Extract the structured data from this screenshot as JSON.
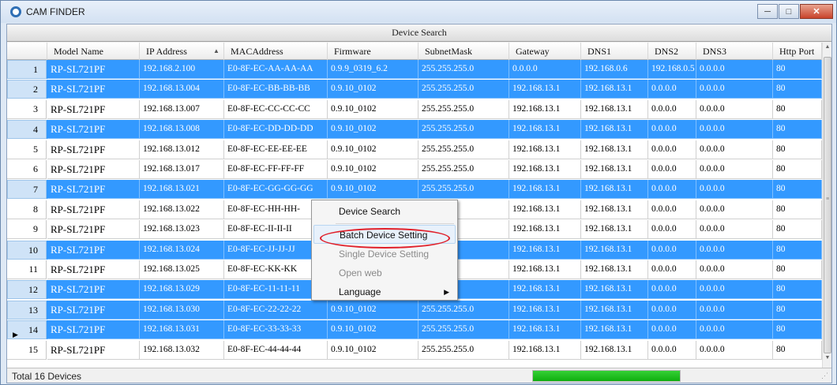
{
  "window": {
    "title": "CAM FINDER",
    "minimize_icon": "minimize-icon",
    "maximize_icon": "maximize-icon",
    "close_icon": "close-icon"
  },
  "toolbar": {
    "device_search_label": "Device Search"
  },
  "table": {
    "columns": [
      "Model Name",
      "IP Address",
      "MACAddress",
      "Firmware",
      "SubnetMask",
      "Gateway",
      "DNS1",
      "DNS2",
      "DNS3",
      "Http Port"
    ],
    "sorted_column": "IP Address",
    "rows": [
      {
        "index": "1",
        "selected": true,
        "model": "RP-SL721PF",
        "ip": "192.168.2.100",
        "mac": "E0-8F-EC-AA-AA-AA",
        "firmware": "0.9.9_0319_6.2",
        "subnet": "255.255.255.0",
        "gateway": "0.0.0.0",
        "dns1": "192.168.0.6",
        "dns2": "192.168.0.5",
        "dns3": "0.0.0.0",
        "port": "80"
      },
      {
        "index": "2",
        "selected": true,
        "model": "RP-SL721PF",
        "ip": "192.168.13.004",
        "mac": "E0-8F-EC-BB-BB-BB",
        "firmware": "0.9.10_0102",
        "subnet": "255.255.255.0",
        "gateway": "192.168.13.1",
        "dns1": "192.168.13.1",
        "dns2": "0.0.0.0",
        "dns3": "0.0.0.0",
        "port": "80"
      },
      {
        "index": "3",
        "selected": false,
        "model": "RP-SL721PF",
        "ip": "192.168.13.007",
        "mac": "E0-8F-EC-CC-CC-CC",
        "firmware": "0.9.10_0102",
        "subnet": "255.255.255.0",
        "gateway": "192.168.13.1",
        "dns1": "192.168.13.1",
        "dns2": "0.0.0.0",
        "dns3": "0.0.0.0",
        "port": "80"
      },
      {
        "index": "4",
        "selected": true,
        "model": "RP-SL721PF",
        "ip": "192.168.13.008",
        "mac": "E0-8F-EC-DD-DD-DD",
        "firmware": "0.9.10_0102",
        "subnet": "255.255.255.0",
        "gateway": "192.168.13.1",
        "dns1": "192.168.13.1",
        "dns2": "0.0.0.0",
        "dns3": "0.0.0.0",
        "port": "80"
      },
      {
        "index": "5",
        "selected": false,
        "model": "RP-SL721PF",
        "ip": "192.168.13.012",
        "mac": "E0-8F-EC-EE-EE-EE",
        "firmware": "0.9.10_0102",
        "subnet": "255.255.255.0",
        "gateway": "192.168.13.1",
        "dns1": "192.168.13.1",
        "dns2": "0.0.0.0",
        "dns3": "0.0.0.0",
        "port": "80"
      },
      {
        "index": "6",
        "selected": false,
        "model": "RP-SL721PF",
        "ip": "192.168.13.017",
        "mac": "E0-8F-EC-FF-FF-FF",
        "firmware": "0.9.10_0102",
        "subnet": "255.255.255.0",
        "gateway": "192.168.13.1",
        "dns1": "192.168.13.1",
        "dns2": "0.0.0.0",
        "dns3": "0.0.0.0",
        "port": "80"
      },
      {
        "index": "7",
        "selected": true,
        "model": "RP-SL721PF",
        "ip": "192.168.13.021",
        "mac": "E0-8F-EC-GG-GG-GG",
        "firmware": "0.9.10_0102",
        "subnet": "255.255.255.0",
        "gateway": "192.168.13.1",
        "dns1": "192.168.13.1",
        "dns2": "0.0.0.0",
        "dns3": "0.0.0.0",
        "port": "80"
      },
      {
        "index": "8",
        "selected": false,
        "model": "RP-SL721PF",
        "ip": "192.168.13.022",
        "mac": "E0-8F-EC-HH-HH-",
        "firmware": "",
        "subnet": "0",
        "gateway": "192.168.13.1",
        "dns1": "192.168.13.1",
        "dns2": "0.0.0.0",
        "dns3": "0.0.0.0",
        "port": "80"
      },
      {
        "index": "9",
        "selected": false,
        "model": "RP-SL721PF",
        "ip": "192.168.13.023",
        "mac": "E0-8F-EC-II-II-II",
        "firmware": "",
        "subnet": "0",
        "gateway": "192.168.13.1",
        "dns1": "192.168.13.1",
        "dns2": "0.0.0.0",
        "dns3": "0.0.0.0",
        "port": "80"
      },
      {
        "index": "10",
        "selected": true,
        "model": "RP-SL721PF",
        "ip": "192.168.13.024",
        "mac": "E0-8F-EC-JJ-JJ-JJ",
        "firmware": "",
        "subnet": "0",
        "gateway": "192.168.13.1",
        "dns1": "192.168.13.1",
        "dns2": "0.0.0.0",
        "dns3": "0.0.0.0",
        "port": "80"
      },
      {
        "index": "11",
        "selected": false,
        "model": "RP-SL721PF",
        "ip": "192.168.13.025",
        "mac": "E0-8F-EC-KK-KK",
        "firmware": "",
        "subnet": "0",
        "gateway": "192.168.13.1",
        "dns1": "192.168.13.1",
        "dns2": "0.0.0.0",
        "dns3": "0.0.0.0",
        "port": "80"
      },
      {
        "index": "12",
        "selected": true,
        "model": "RP-SL721PF",
        "ip": "192.168.13.029",
        "mac": "E0-8F-EC-11-11-11",
        "firmware": "",
        "subnet": "0",
        "gateway": "192.168.13.1",
        "dns1": "192.168.13.1",
        "dns2": "0.0.0.0",
        "dns3": "0.0.0.0",
        "port": "80"
      },
      {
        "index": "13",
        "selected": true,
        "model": "RP-SL721PF",
        "ip": "192.168.13.030",
        "mac": "E0-8F-EC-22-22-22",
        "firmware": "0.9.10_0102",
        "subnet": "255.255.255.0",
        "gateway": "192.168.13.1",
        "dns1": "192.168.13.1",
        "dns2": "0.0.0.0",
        "dns3": "0.0.0.0",
        "port": "80"
      },
      {
        "index": "14",
        "selected": true,
        "current": true,
        "model": "RP-SL721PF",
        "ip": "192.168.13.031",
        "mac": "E0-8F-EC-33-33-33",
        "firmware": "0.9.10_0102",
        "subnet": "255.255.255.0",
        "gateway": "192.168.13.1",
        "dns1": "192.168.13.1",
        "dns2": "0.0.0.0",
        "dns3": "0.0.0.0",
        "port": "80"
      },
      {
        "index": "15",
        "selected": false,
        "model": "RP-SL721PF",
        "ip": "192.168.13.032",
        "mac": "E0-8F-EC-44-44-44",
        "firmware": "0.9.10_0102",
        "subnet": "255.255.255.0",
        "gateway": "192.168.13.1",
        "dns1": "192.168.13.1",
        "dns2": "0.0.0.0",
        "dns3": "0.0.0.0",
        "port": "80"
      }
    ]
  },
  "context_menu": {
    "items": [
      {
        "label": "Device Search",
        "disabled": false
      },
      {
        "label": "Batch Device Setting",
        "disabled": false,
        "highlighted": true
      },
      {
        "label": "Single Device Setting",
        "disabled": true
      },
      {
        "label": "Open web",
        "disabled": true
      },
      {
        "label": "Language",
        "disabled": false,
        "submenu": true
      }
    ]
  },
  "status": {
    "text": "Total 16 Devices",
    "progress_fraction": 1.0
  },
  "colors": {
    "selection": "#3399ff",
    "progress": "#1bbf1b",
    "annotation_ring": "#e0202a"
  }
}
